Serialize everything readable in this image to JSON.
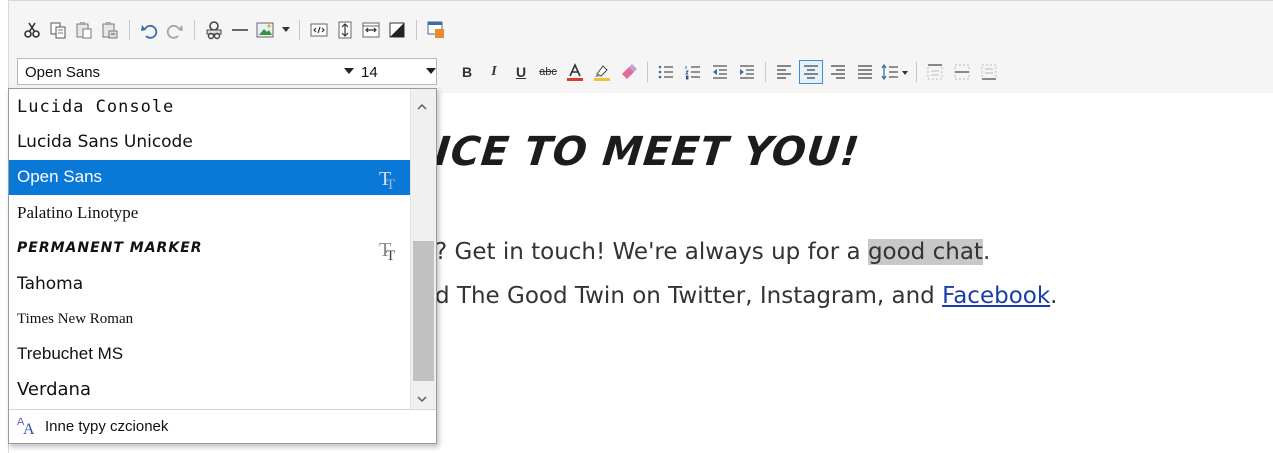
{
  "toolbar": {
    "font_family_value": "Open Sans",
    "font_size_value": "14",
    "top_icons": [
      "cut-icon",
      "copy-icon",
      "paste-icon",
      "paste-special-icon",
      "undo-icon",
      "redo-icon",
      "link-icon",
      "horizontal-rule-icon",
      "image-icon",
      "source-code-icon",
      "insert-break-icon",
      "fit-width-icon",
      "contrast-icon",
      "template-icon"
    ],
    "format_buttons": {
      "bold": "B",
      "italic": "I",
      "underline": "U",
      "strikethrough": "abc"
    }
  },
  "font_dropdown": {
    "items": [
      {
        "label": "Lucida Console",
        "selected": false,
        "truetype": false
      },
      {
        "label": "Lucida Sans Unicode",
        "selected": false,
        "truetype": false
      },
      {
        "label": "Open Sans",
        "selected": true,
        "truetype": true
      },
      {
        "label": "Palatino Linotype",
        "selected": false,
        "truetype": false
      },
      {
        "label": "Permanent Marker",
        "selected": false,
        "truetype": true
      },
      {
        "label": "Tahoma",
        "selected": false,
        "truetype": false
      },
      {
        "label": "Times New Roman",
        "selected": false,
        "truetype": false
      },
      {
        "label": "Trebuchet MS",
        "selected": false,
        "truetype": false
      },
      {
        "label": "Verdana",
        "selected": false,
        "truetype": false
      }
    ],
    "more_fonts_label": "Inne typy czcionek"
  },
  "editor": {
    "heading": "ICE TO MEET YOU!",
    "line1_before": "? Get in touch! We're always up for a ",
    "line1_highlight": "good chat",
    "line1_after": ".",
    "line2_before": "d The Good Twin on Twitter, Instagram, and ",
    "line2_link": "Facebook",
    "line2_after": "."
  },
  "colors": {
    "selection": "#0a78d7",
    "highlight": "#c8c8c8",
    "link": "#1a3ea8",
    "font_color_bar": "#e03a2f",
    "highlight_bar": "#f2c12e"
  }
}
